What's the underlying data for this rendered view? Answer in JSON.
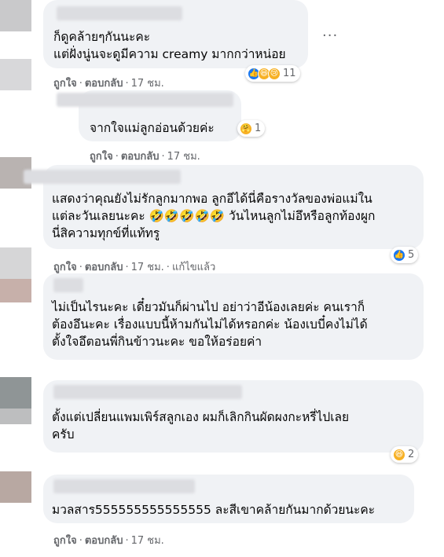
{
  "comments": [
    {
      "text_lines": [
        "ก็ดูคล้ายๆกันนะคะ",
        "แต่ฝั่งนู่นจะดูมีความ creamy มากกว่าหน่อย"
      ],
      "actions": {
        "like": "ถูกใจ",
        "reply": "ตอบกลับ",
        "time": "17 ชม."
      },
      "reactions": {
        "icons": [
          "like-icon",
          "haha-icon",
          "sad-icon"
        ],
        "count": "11"
      },
      "more_label": "···"
    },
    {
      "text_lines": [
        "จากใจแม่ลูกอ่อนด้วยค่ะ"
      ],
      "actions": {
        "like": "ถูกใจ",
        "reply": "ตอบกลับ",
        "time": "17 ชม."
      },
      "reactions": {
        "icons": [
          "care-icon"
        ],
        "count": "1"
      }
    },
    {
      "text_lines": [
        "แสดงว่าคุณยังไม่รักลูกมากพอ ลูกอีได้นี่คือรางวัลของพ่อแม่ใน",
        "แต่ละวันเลยนะคะ 🤣🤣🤣🤣🤣 วันไหนลูกไม่อึหรือลูกท้องผูก",
        "นี่สิความทุกข์ที่แท้ทรู"
      ],
      "actions": {
        "like": "ถูกใจ",
        "reply": "ตอบกลับ",
        "time": "17 ชม.",
        "edited": "แก้ไขแล้ว"
      },
      "reactions": {
        "icons": [
          "like-icon"
        ],
        "count": "5"
      }
    },
    {
      "text_lines": [
        "ไม่เป็นไรนะคะ เดี๋ยวมันก็ผ่านไป อย่าว่าอีน้องเลยค่ะ คนเราก็",
        "ต้องอึนะคะ เรื่องแบบนี้ห้ามกันไม่ได้หรอกค่ะ น้องเบบี๋คงไม่ได้",
        "ตั้งใจอึตอนพี่กินข้าวนะคะ ขอให้อร่อยค่า"
      ]
    },
    {
      "text_lines": [
        "ตั้งแต่เปลี่ยนแพมเพิร์สลูกเอง ผมก็เลิกกินผัดผงกะหรี่ไปเลย",
        "ครับ"
      ],
      "reactions": {
        "icons": [
          "haha-icon"
        ],
        "count": "2"
      }
    },
    {
      "text_lines": [
        "มวลสาร555555555555555 ละสีเขาคล้ายกันมากด้วยนะคะ"
      ],
      "actions": {
        "like": "ถูกใจ",
        "reply": "ตอบกลับ",
        "time": "17 ชม."
      }
    }
  ]
}
